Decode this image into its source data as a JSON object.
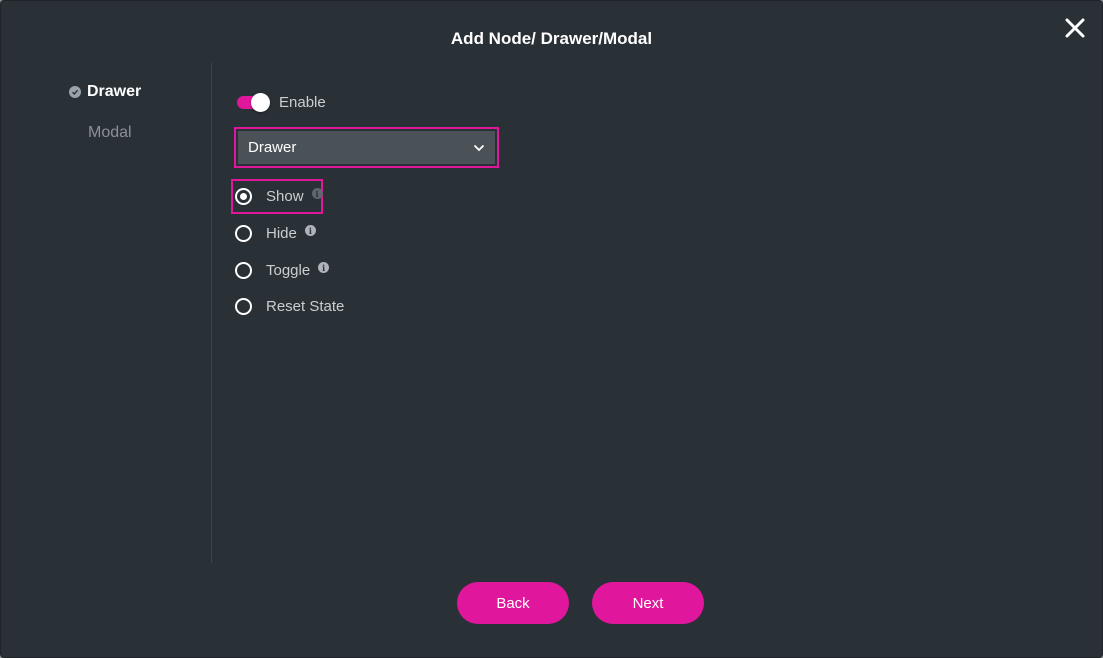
{
  "dialog": {
    "title": "Add Node/ Drawer/Modal"
  },
  "steps": [
    {
      "label": "Drawer",
      "state": "completed"
    },
    {
      "label": "Modal",
      "state": "inactive"
    }
  ],
  "enable_toggle": {
    "label": "Enable",
    "on": true
  },
  "type_select": {
    "value": "Drawer"
  },
  "actions": [
    {
      "label": "Show",
      "checked": true,
      "has_info": true
    },
    {
      "label": "Hide",
      "checked": false,
      "has_info": true
    },
    {
      "label": "Toggle",
      "checked": false,
      "has_info": true
    },
    {
      "label": "Reset State",
      "checked": false,
      "has_info": false
    }
  ],
  "footer": {
    "back_label": "Back",
    "next_label": "Next"
  },
  "colors": {
    "accent": "#e0179c",
    "background": "#293036",
    "select_bg": "#4a5257"
  },
  "icons": {
    "close": "close-icon",
    "step_done": "check-circle-icon",
    "select": "chevron-down-icon",
    "info": "info-icon"
  }
}
